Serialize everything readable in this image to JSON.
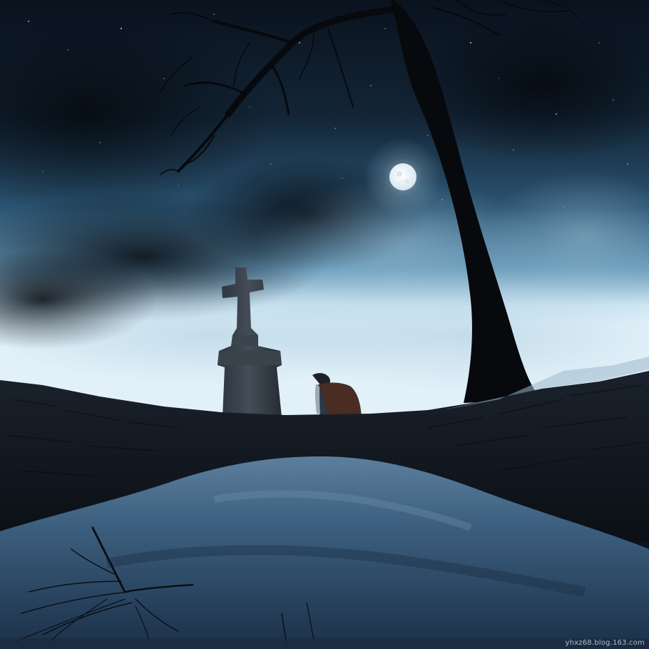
{
  "watermark": "yhxz68.blog.163.com",
  "colors": {
    "sky_top": "#0c1624",
    "sky_mid": "#2c5a78",
    "horizon_glow": "#d9ecf6",
    "moon": "#f2f6fa",
    "wall": "#121820",
    "snow": "#2b4a66",
    "silhouette": "#0a0d12"
  },
  "icons": [
    "moon",
    "stone-cross",
    "kneeling-person",
    "bare-tree"
  ]
}
